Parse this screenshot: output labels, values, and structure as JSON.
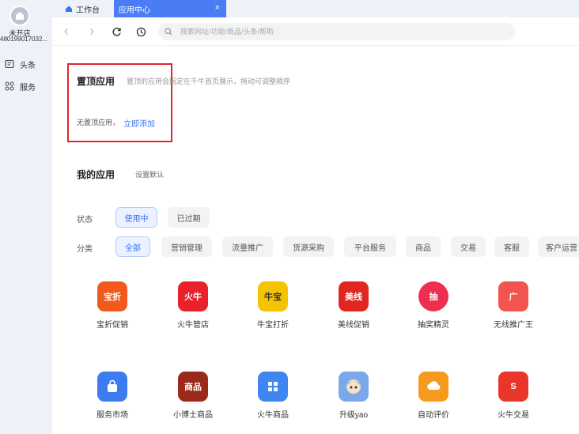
{
  "sidebar": {
    "shop_name": "未开店",
    "shop_id": "480199017032...",
    "items": [
      {
        "label": "头条",
        "icon": "news-icon"
      },
      {
        "label": "服务",
        "icon": "grid-icon"
      }
    ]
  },
  "tabs": {
    "home_label": "工作台",
    "active_label": "应用中心",
    "close_glyph": "×"
  },
  "navbar": {
    "search_placeholder": "搜索网址/功能/商品/头条/帮助"
  },
  "pinned": {
    "title": "置顶应用",
    "description": "置顶的应用会固定在千牛首页展示，拖动可调整顺序",
    "empty_text": "无置顶应用，",
    "add_link": "立即添加"
  },
  "my_apps": {
    "title": "我的应用",
    "set_default": "设置默认",
    "status_label": "状态",
    "status_options": [
      {
        "label": "使用中",
        "active": true
      },
      {
        "label": "已过期",
        "active": false
      }
    ],
    "category_label": "分类",
    "categories": [
      {
        "label": "全部",
        "active": true
      },
      {
        "label": "营销管理",
        "active": false
      },
      {
        "label": "流量推广",
        "active": false
      },
      {
        "label": "货源采购",
        "active": false
      },
      {
        "label": "平台服务",
        "active": false
      },
      {
        "label": "商品",
        "active": false
      },
      {
        "label": "交易",
        "active": false
      },
      {
        "label": "客服",
        "active": false
      },
      {
        "label": "客户运营",
        "active": false
      }
    ],
    "apps": [
      {
        "name": "宝折促销",
        "icon_text": "宝折",
        "color": "#f25a1d"
      },
      {
        "name": "火牛管店",
        "icon_text": "火牛",
        "color": "#e8212b"
      },
      {
        "name": "牛宝打折",
        "icon_text": "牛宝",
        "color": "#f5c400"
      },
      {
        "name": "美线促销",
        "icon_text": "美线",
        "color": "#e0261f"
      },
      {
        "name": "抽奖精灵",
        "icon_text": "抽",
        "color": "#ee2f4f"
      },
      {
        "name": "无线推广王",
        "icon_text": "广",
        "color": "#f2544f"
      },
      {
        "name": "服务市场",
        "icon_text": "",
        "color": "#3d7cf0"
      },
      {
        "name": "小博士商品",
        "icon_text": "商品",
        "color": "#9b2a1b"
      },
      {
        "name": "火牛商品",
        "icon_text": "",
        "color": "#3f86f2"
      },
      {
        "name": "升级yao",
        "icon_text": "",
        "color": "#7aa8e8"
      },
      {
        "name": "自动评价",
        "icon_text": "",
        "color": "#f59a1f"
      },
      {
        "name": "火牛交易",
        "icon_text": "S",
        "color": "#e8362c"
      }
    ]
  }
}
